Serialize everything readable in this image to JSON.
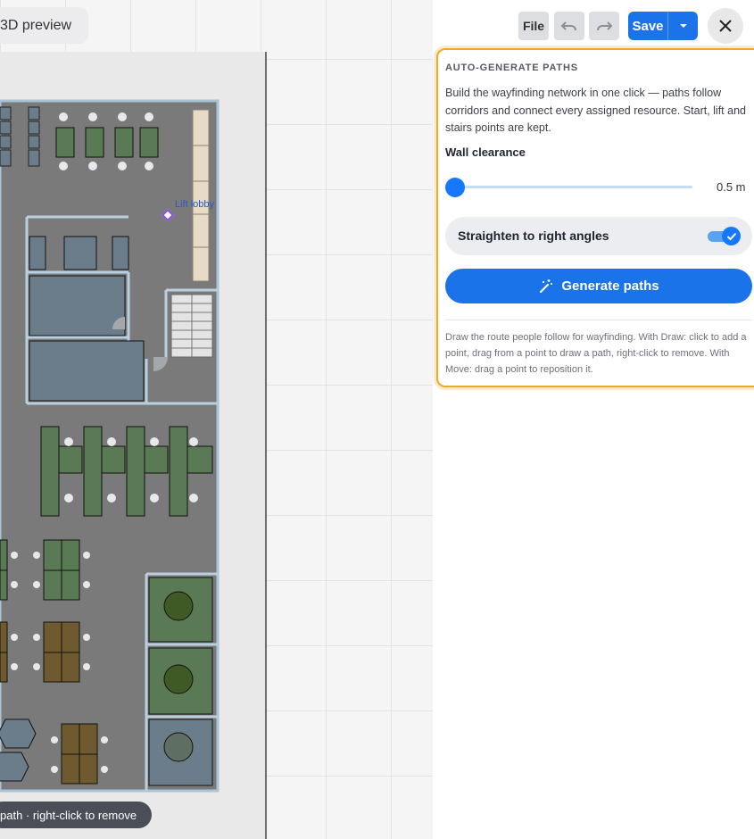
{
  "toolbar": {
    "preview_label": "3D preview",
    "file_label": "File",
    "undo_icon": "undo-icon",
    "redo_icon": "redo-icon",
    "save_label": "Save",
    "save_dropdown_icon": "caret-down-icon",
    "close_icon": "close-icon"
  },
  "canvas": {
    "lobby_label": "Lift lobby",
    "hint": "path · right-click to remove"
  },
  "panel": {
    "title": "AUTO-GENERATE PATHS",
    "description": "Build the wayfinding network in one click — paths follow corridors and connect every assigned resource. Start, lift and stairs points are kept.",
    "wall_clearance_label": "Wall clearance",
    "wall_clearance_value": "0.5 m",
    "wall_clearance_fraction": 0.0,
    "straighten_label": "Straighten to right angles",
    "straighten_on": true,
    "generate_label": "Generate paths",
    "generate_icon": "magic-wand-icon",
    "help": "Draw the route people follow for wayfinding. With Draw: click to add a point, drag from a point to draw a path, right-click to remove. With Move: drag a point to reposition it."
  },
  "colors": {
    "accent": "#1a73e8",
    "panel_border": "#f5a623",
    "floor": "#7a7a7a",
    "desk_green": "#5a7a55",
    "desk_brown": "#6e5a2e",
    "room": "#6b7d8a"
  }
}
